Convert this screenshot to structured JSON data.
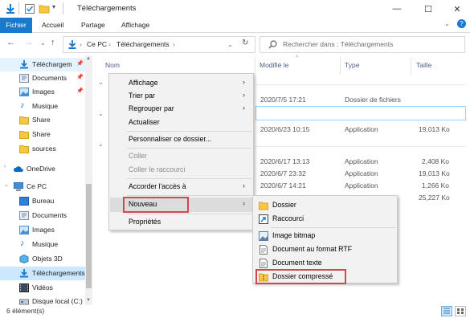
{
  "window": {
    "title": "Téléchargements",
    "controls": [
      "minimize-icon",
      "maximize-icon",
      "close-icon"
    ]
  },
  "ribbon": {
    "tabs": [
      "Fichier",
      "Accueil",
      "Partage",
      "Affichage"
    ],
    "accent": "#1979ca"
  },
  "address": {
    "parts": [
      "Ce PC",
      "Téléchargements"
    ],
    "search_placeholder": "Rechercher dans : Téléchargements"
  },
  "sidebar": {
    "items": [
      {
        "label": "Téléchargem",
        "icon": "download-icon",
        "pinned": true
      },
      {
        "label": "Documents",
        "icon": "documents-icon",
        "pinned": true
      },
      {
        "label": "Images",
        "icon": "images-icon",
        "pinned": true
      },
      {
        "label": "Musique",
        "icon": "music-icon",
        "pinned": false
      },
      {
        "label": "Share",
        "icon": "folder-icon",
        "pinned": false
      },
      {
        "label": "Share",
        "icon": "folder-icon",
        "pinned": false
      },
      {
        "label": "sources",
        "icon": "folder-icon",
        "pinned": false
      },
      {
        "label": "OneDrive",
        "icon": "cloud-icon",
        "pinned": false
      },
      {
        "label": "Ce PC",
        "icon": "computer-icon",
        "pinned": false
      },
      {
        "label": "Bureau",
        "icon": "desktop-icon",
        "pinned": false
      },
      {
        "label": "Documents",
        "icon": "documents-icon",
        "pinned": false
      },
      {
        "label": "Images",
        "icon": "images-icon",
        "pinned": false
      },
      {
        "label": "Musique",
        "icon": "music-icon",
        "pinned": false
      },
      {
        "label": "Objets 3D",
        "icon": "objects3d-icon",
        "pinned": false
      },
      {
        "label": "Téléchargements",
        "icon": "download-icon",
        "pinned": false,
        "selected": true
      },
      {
        "label": "Vidéos",
        "icon": "video-icon",
        "pinned": false
      },
      {
        "label": "Disque local (C:)",
        "icon": "drive-icon",
        "pinned": false
      }
    ]
  },
  "columns": [
    "Nom",
    "Modifié le",
    "Type",
    "Taille"
  ],
  "files": [
    {
      "modified": "2020/7/5 17:21",
      "type": "Dossier de fichiers",
      "size": ""
    },
    {
      "modified": "2020/6/23 10:15",
      "type": "Application",
      "size": "19,013 Ko"
    },
    {
      "modified": "2020/6/17 13:13",
      "type": "Application",
      "size": "2,408 Ko"
    },
    {
      "modified": "2020/6/7 23:32",
      "type": "Application",
      "size": "19,013 Ko"
    },
    {
      "modified": "2020/6/7 14:21",
      "type": "Application",
      "size": "1,266 Ko"
    },
    {
      "modified": "",
      "type": "",
      "size": "25,227 Ko"
    }
  ],
  "context_menu": {
    "items": [
      "Affichage",
      "Trier par",
      "Regrouper par",
      "Actualiser",
      "Personnaliser ce dossier...",
      "Coller",
      "Coller le raccourci",
      "Accorder l'accès à",
      "Nouveau",
      "Propriétés"
    ]
  },
  "submenu": {
    "items": [
      "Dossier",
      "Raccourci",
      "Image bitmap",
      "Document au format RTF",
      "Document texte",
      "Dossier compressé"
    ]
  },
  "status": {
    "count": "6 élément(s)"
  },
  "colors": {
    "highlight_box": "#d0484d",
    "selection": "#cce8ff",
    "folder": "#f6c644",
    "menu_bg": "#f2f2f2"
  }
}
